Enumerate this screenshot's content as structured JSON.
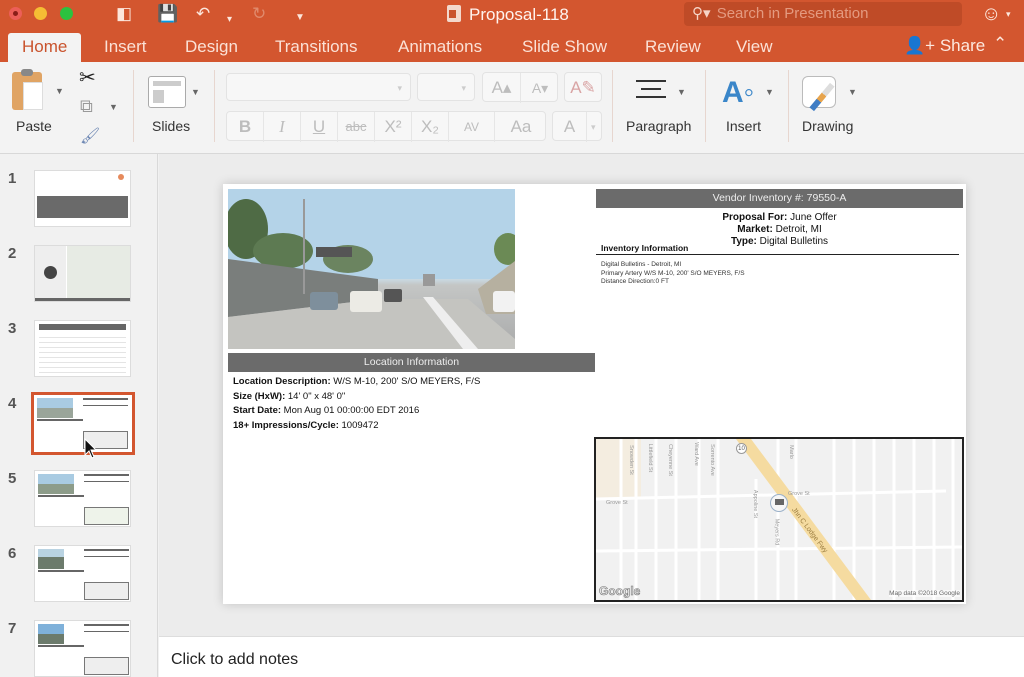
{
  "window": {
    "title": "Proposal-118",
    "search_placeholder": "Search in Presentation",
    "icons": [
      "sidebar-icon",
      "save-icon",
      "undo-icon",
      "redo-icon",
      "customize-icon",
      "smiley-feedback-icon"
    ]
  },
  "tabs": [
    {
      "label": "Home",
      "active": true
    },
    {
      "label": "Insert"
    },
    {
      "label": "Design"
    },
    {
      "label": "Transitions"
    },
    {
      "label": "Animations"
    },
    {
      "label": "Slide Show"
    },
    {
      "label": "Review"
    },
    {
      "label": "View"
    }
  ],
  "share_label": "Share",
  "ribbon": {
    "paste": "Paste",
    "slides": "Slides",
    "paragraph": "Paragraph",
    "insert": "Insert",
    "drawing": "Drawing",
    "font_name": "",
    "font_size": "",
    "format_buttons": [
      "B",
      "I",
      "U",
      "abc",
      "X²",
      "X₂",
      "AV",
      "Aa",
      "A"
    ],
    "grow_shrink": [
      "A▴",
      "A▾"
    ]
  },
  "thumbnails": [
    {
      "num": "1"
    },
    {
      "num": "2"
    },
    {
      "num": "3"
    },
    {
      "num": "4",
      "selected": true
    },
    {
      "num": "5"
    },
    {
      "num": "6"
    },
    {
      "num": "7"
    }
  ],
  "slide": {
    "vendor_header": "Vendor Inventory #: 79550-A",
    "proposal_for_label": "Proposal For:",
    "proposal_for": " June Offer",
    "market_label": "Market:",
    "market": " Detroit, MI",
    "type_label": "Type:",
    "type": " Digital Bulletins",
    "inventory_heading": "Inventory Information",
    "inventory_lines": [
      "Digital Bulletins - Detroit, MI",
      "Primary Artery W/S M-10, 200' S/O MEYERS, F/S",
      "Distance Direction:0 FT"
    ],
    "location_header": "Location Information",
    "location_description_label": "Location Description:",
    "location_description": " W/S M-10, 200' S/O MEYERS, F/S",
    "size_label": "Size (HxW):",
    "size": " 14' 0\" x 48' 0\"",
    "start_date_label": "Start Date:",
    "start_date": " Mon Aug 01 00:00:00 EDT 2016",
    "impressions_label": "18+ Impressions/Cycle:",
    "impressions": " 1009472",
    "map": {
      "streets": [
        "Grove St",
        "Grove St",
        "Meyers Rd",
        "Appoline St",
        "Jhn C Lodge Fwy",
        "Marlo",
        "Sorrento Ave",
        "Ward Ave",
        "Cheyenne St",
        "Littlefield St",
        "Snowden St"
      ],
      "route_marker": "10",
      "logo": "Google",
      "attribution": "Map data ©2018 Google"
    }
  },
  "notes_placeholder": "Click to add notes"
}
